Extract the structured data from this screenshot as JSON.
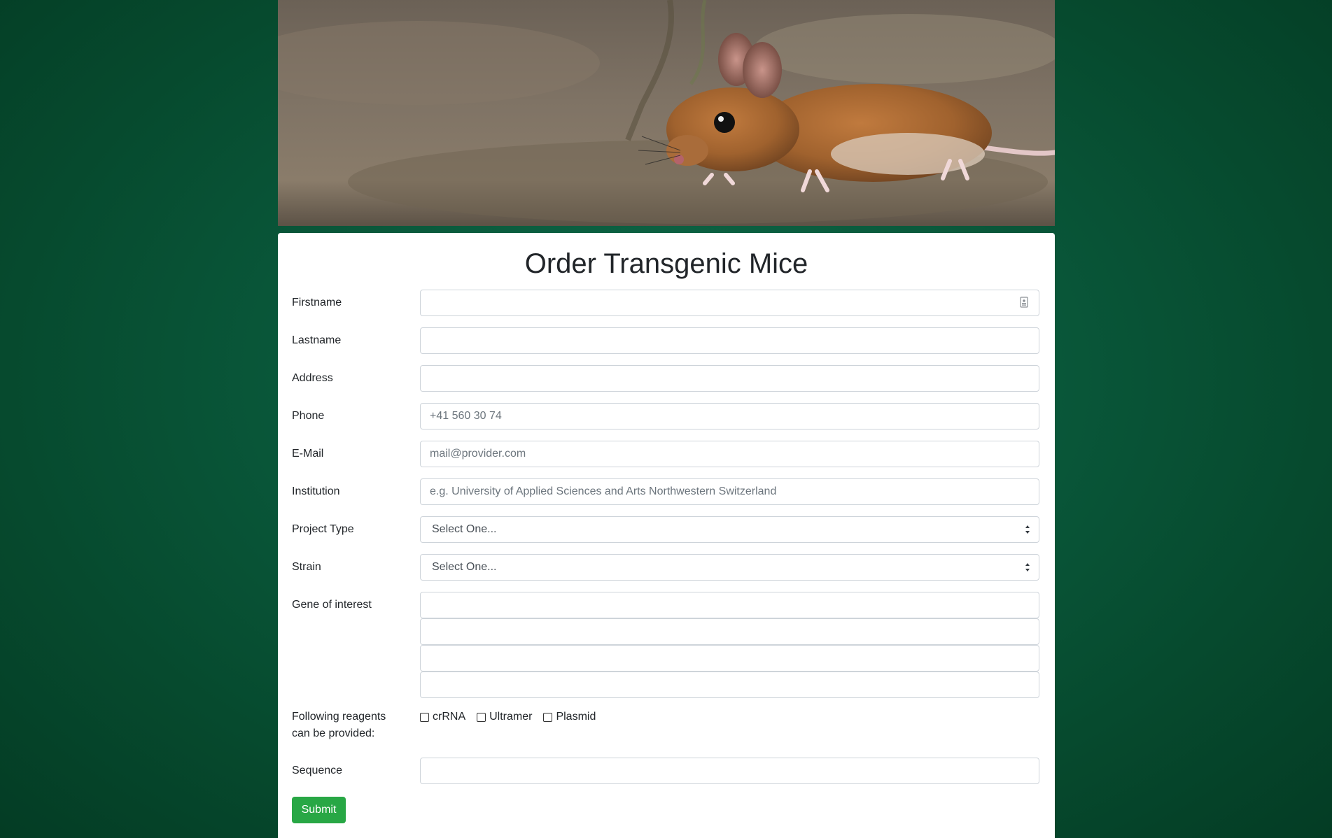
{
  "hero": {
    "image_alt": "mouse-photo"
  },
  "form": {
    "title": "Order Transgenic Mice",
    "fields": {
      "firstname": {
        "label": "Firstname",
        "value": "",
        "placeholder": ""
      },
      "lastname": {
        "label": "Lastname",
        "value": "",
        "placeholder": ""
      },
      "address": {
        "label": "Address",
        "value": "",
        "placeholder": ""
      },
      "phone": {
        "label": "Phone",
        "value": "",
        "placeholder": "+41 560 30 74"
      },
      "email": {
        "label": "E-Mail",
        "value": "",
        "placeholder": "mail@provider.com"
      },
      "institution": {
        "label": "Institution",
        "value": "",
        "placeholder": "e.g. University of Applied Sciences and Arts Northwestern Switzerland"
      },
      "project_type": {
        "label": "Project Type",
        "selected": "Select One..."
      },
      "strain": {
        "label": "Strain",
        "selected": "Select One..."
      },
      "gene_of_interest": {
        "label": "Gene of interest"
      },
      "reagents": {
        "label_line1": "Following reagents",
        "label_line2": "can be provided:",
        "options": [
          "crRNA",
          "Ultramer",
          "Plasmid"
        ]
      },
      "sequence": {
        "label": "Sequence",
        "value": "",
        "placeholder": ""
      }
    },
    "submit_label": "Submit"
  },
  "colors": {
    "background": "#064a2e",
    "accent": "#28a745",
    "card": "#ffffff"
  },
  "icons": {
    "autofill": "contact-card-icon",
    "select": "up-down-arrows-icon"
  }
}
